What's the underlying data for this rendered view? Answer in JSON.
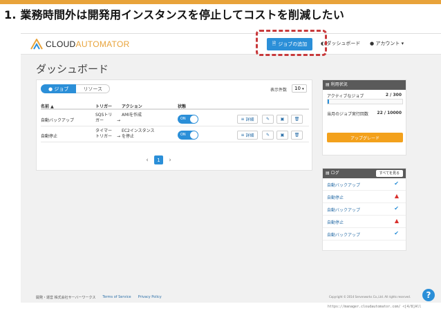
{
  "slide_title": "1. 業務時間外は開発用インスタンスを停止してコストを削減したい",
  "header": {
    "logo_main": "CLOUD",
    "logo_accent": "AUTOMATOR",
    "add_job_label": "ジョブの追加",
    "dashboard_label": "ダッシュボード",
    "account_label": "アカウント ▾"
  },
  "page_title": "ダッシュボード",
  "tabs": [
    {
      "label": "● ジョブ"
    },
    {
      "label": "リソース"
    }
  ],
  "per_page": {
    "label": "表示件数",
    "value": "10"
  },
  "table": {
    "headers": {
      "name": "名前 ▲",
      "trigger": "トリガー",
      "action": "アクション",
      "status": "状態"
    },
    "rows": [
      {
        "name": "自動バックアップ",
        "trigger": "SQSトリガー",
        "action": "AMIを作成",
        "status": "ON"
      },
      {
        "name": "自動停止",
        "trigger": "タイマートリガー",
        "action": "EC2インスタンスを停止",
        "status": "ON"
      }
    ],
    "detail_label": "詳細"
  },
  "pager": {
    "prev": "‹",
    "current": "1",
    "next": "›"
  },
  "usage": {
    "title": "利用状況",
    "active_label": "アクティブなジョブ",
    "active_value": "2 / 300",
    "active_fraction": 0.0067,
    "monthly_label": "当月のジョブ実行回数",
    "monthly_value": "22 / 10000",
    "monthly_fraction": 0.0022,
    "upgrade_label": "アップグレード"
  },
  "log": {
    "title": "ログ",
    "see_all": "すべてを見る",
    "items": [
      {
        "label": "自動バックアップ",
        "status": "success"
      },
      {
        "label": "自動停止",
        "status": "error"
      },
      {
        "label": "自動バックアップ",
        "status": "success"
      },
      {
        "label": "自動停止",
        "status": "error"
      },
      {
        "label": "自動バックアップ",
        "status": "success"
      }
    ]
  },
  "footer": {
    "company": "開発・運営 株式会社サーバーワークス",
    "terms": "Terms of Service",
    "privacy": "Privacy Policy",
    "copyright": "Copyright © 2014 Serverworks Co.,Ltd. All rights reserved."
  },
  "help_label": "?",
  "url_text": "https://manager.cloudautomator.com/ <[4/8]All",
  "colors": {
    "accent_blue": "#2b8fd8",
    "accent_orange": "#f3a11c",
    "highlight_red": "#c8393b",
    "success": "#2b8fd8",
    "error": "#d9302c"
  }
}
